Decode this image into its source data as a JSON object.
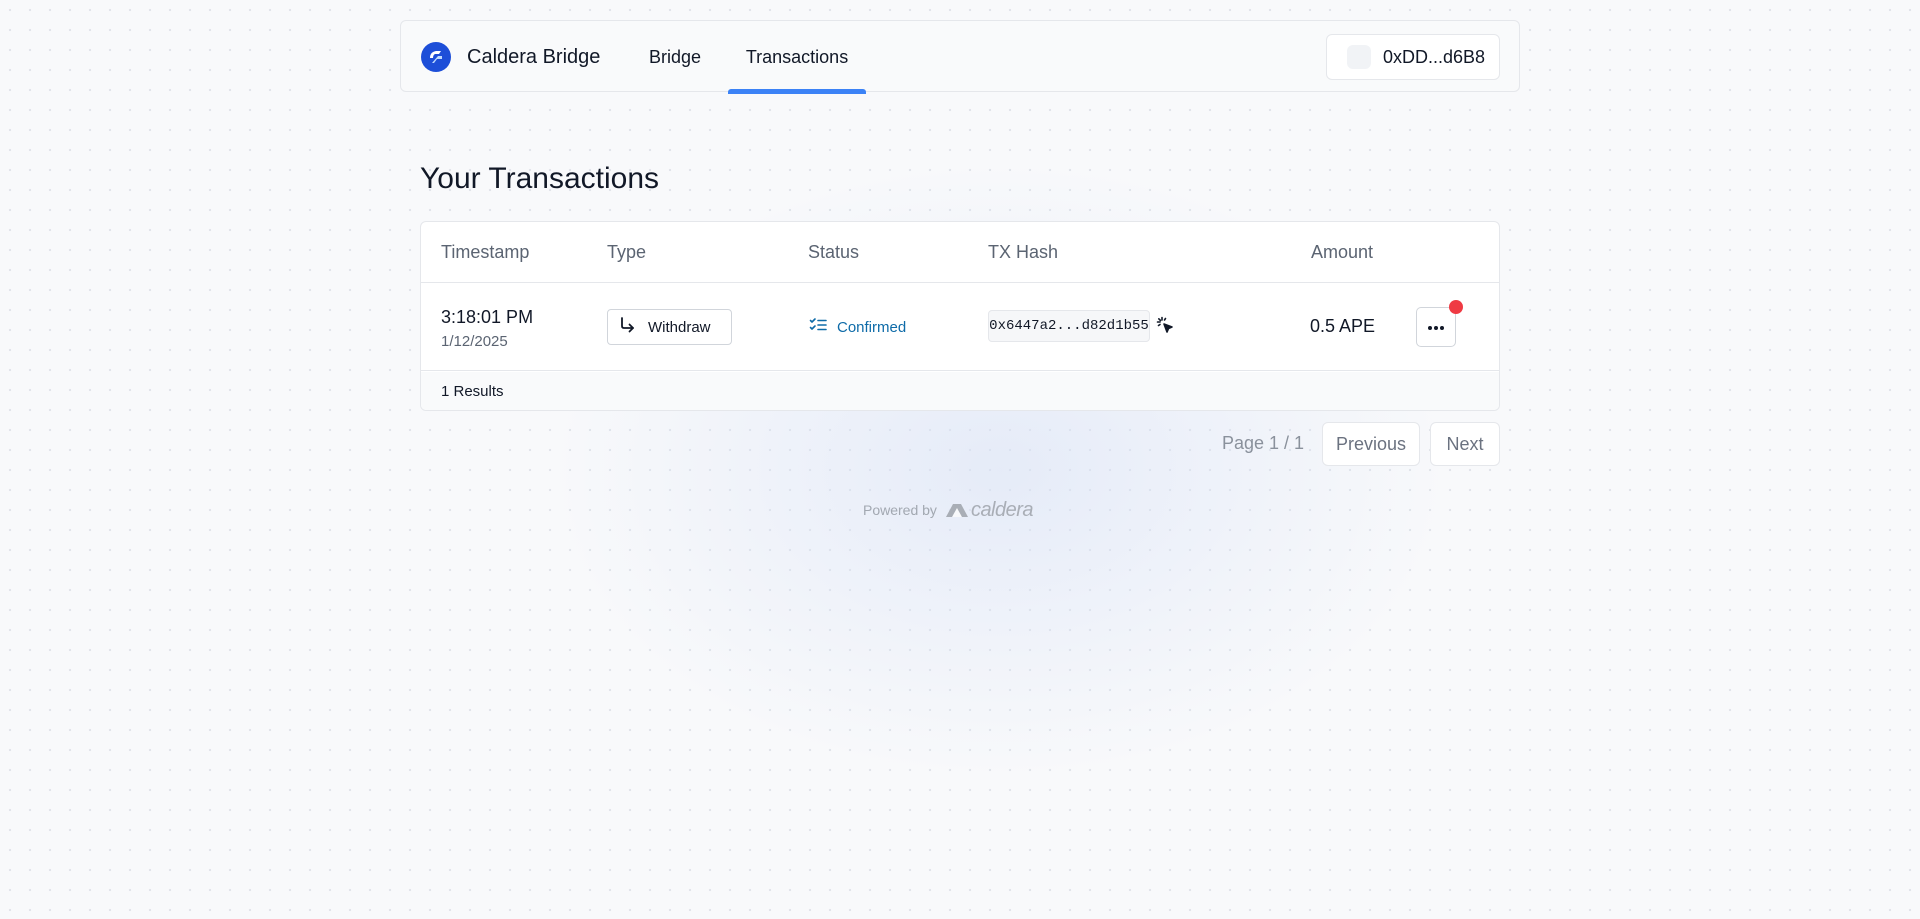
{
  "nav": {
    "brand": "Caldera Bridge",
    "tabs": [
      {
        "label": "Bridge",
        "active": false
      },
      {
        "label": "Transactions",
        "active": true
      }
    ],
    "wallet_address": "0xDD...d6B8"
  },
  "page": {
    "title": "Your Transactions"
  },
  "table": {
    "columns": [
      "Timestamp",
      "Type",
      "Status",
      "TX Hash",
      "Amount"
    ],
    "rows": [
      {
        "time": "3:18:01 PM",
        "date": "1/12/2025",
        "type": "Withdraw",
        "type_icon": "arrow-down-right-icon",
        "status": "Confirmed",
        "status_icon": "checklist-icon",
        "tx_hash": "0x6447a2...d82d1b55",
        "amount": "0.5 APE"
      }
    ],
    "results": "1 Results"
  },
  "pagination": {
    "page_label": "Page 1 / 1",
    "previous": "Previous",
    "next": "Next"
  },
  "footer": {
    "powered_by": "Powered by",
    "logo_text": "caldera"
  },
  "colors": {
    "accent": "#3b82f6",
    "status_confirmed": "#0e6ba8",
    "notification": "#ef3a43",
    "brand_logo": "#1d4ed8"
  }
}
